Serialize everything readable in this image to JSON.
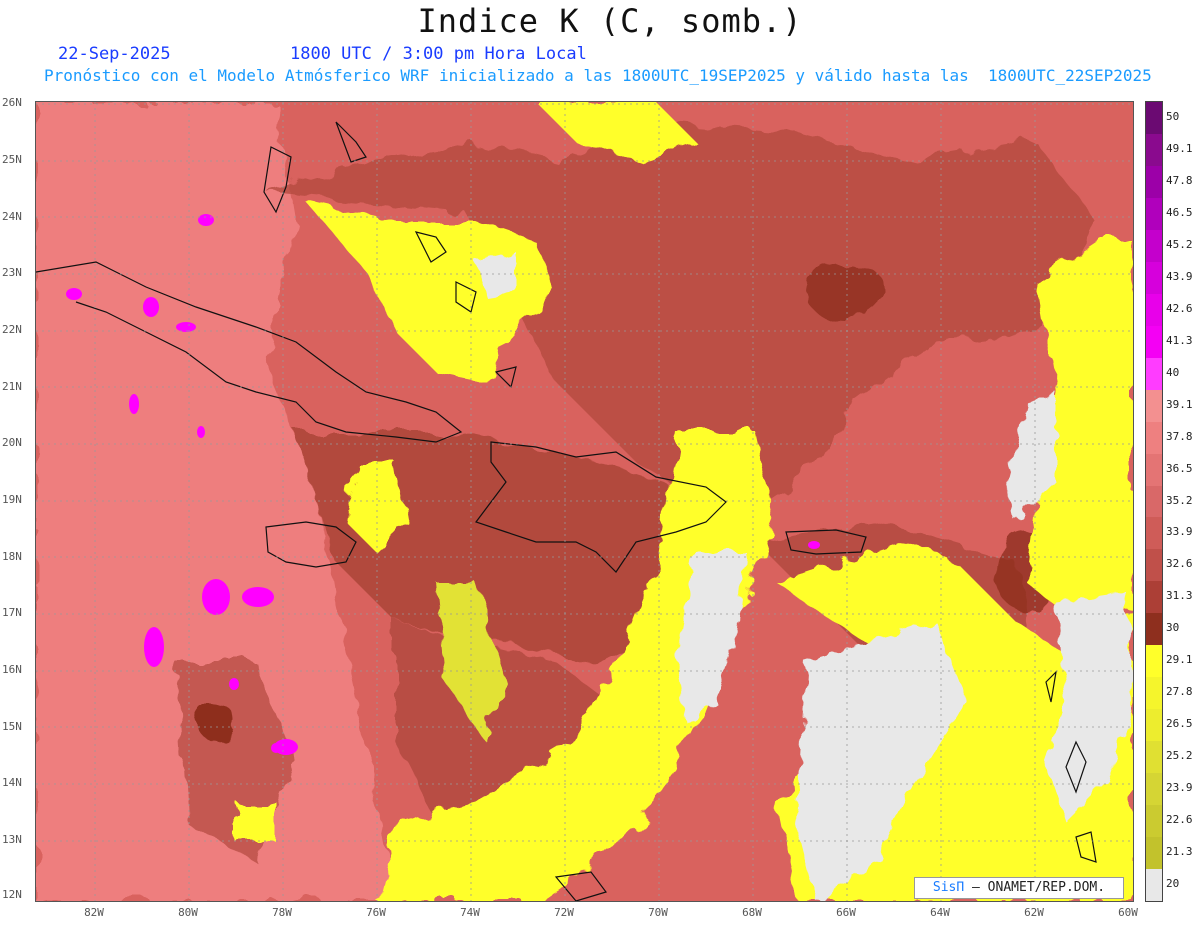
{
  "header": {
    "title": "Indice K (C, somb.)",
    "date": "22-Sep-2025",
    "time": "1800 UTC / 3:00 pm Hora Local",
    "subtitle": "Pronóstico con el Modelo Atmósferico WRF inicializado a las 1800UTC_19SEP2025 y válido hasta las  1800UTC_22SEP2025"
  },
  "axes": {
    "lat_labels": [
      "26N",
      "25N",
      "24N",
      "23N",
      "22N",
      "21N",
      "20N",
      "19N",
      "18N",
      "17N",
      "16N",
      "15N",
      "14N",
      "13N",
      "12N"
    ],
    "lon_labels": [
      "82W",
      "80W",
      "78W",
      "76W",
      "74W",
      "72W",
      "70W",
      "68W",
      "66W",
      "64W",
      "62W",
      "60W"
    ]
  },
  "colorbar": {
    "levels": [
      "50",
      "49.1",
      "47.8",
      "46.5",
      "45.2",
      "43.9",
      "42.6",
      "41.3",
      "40",
      "39.1",
      "37.8",
      "36.5",
      "35.2",
      "33.9",
      "32.6",
      "31.3",
      "30",
      "29.1",
      "27.8",
      "26.5",
      "25.2",
      "23.9",
      "22.6",
      "21.3",
      "20"
    ],
    "colors": [
      "#6b0a72",
      "#8a0a8e",
      "#9c00a8",
      "#b000bc",
      "#c400cc",
      "#d600dc",
      "#e800ea",
      "#f400f4",
      "#ff3cff",
      "#f39090",
      "#ee8080",
      "#e47474",
      "#d96868",
      "#cf5c58",
      "#c0504a",
      "#ac3f36",
      "#8e2f1e",
      "#ffff2a",
      "#f5f52c",
      "#eded2e",
      "#e0e032",
      "#d5d534",
      "#cbcb30",
      "#c2c22c",
      "#e8e8e8"
    ]
  },
  "map_colors": {
    "pink": "#ee7e7e",
    "salmon": "#d9625e",
    "brown": "#b24a3e",
    "dark_brown": "#8e2f1e",
    "yellow": "#ffff2a",
    "olive_yellow": "#e2e236",
    "light_gray": "#e8e8e8",
    "magenta": "#ff00ff"
  },
  "credit": {
    "brand": "SisΠ",
    "text": "– ONAMET/REP.DOM."
  }
}
